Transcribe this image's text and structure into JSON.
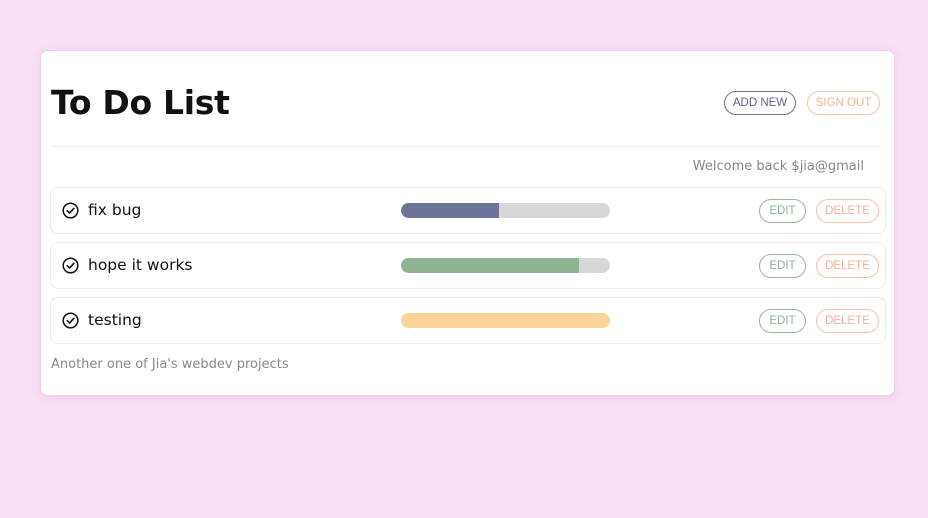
{
  "header": {
    "title": "To Do List",
    "add_label": "ADD NEW",
    "signout_label": "SIGN OUT"
  },
  "welcome": "Welcome back $jia@gmail",
  "tasks": [
    {
      "label": "fix bug",
      "progress": 0.47,
      "color": "#6e7399",
      "edit_label": "EDIT",
      "delete_label": "DELETE",
      "icon": "check-circle-icon"
    },
    {
      "label": "hope it works",
      "progress": 0.85,
      "color": "#8eb493",
      "edit_label": "EDIT",
      "delete_label": "DELETE",
      "icon": "check-circle-icon"
    },
    {
      "label": "testing",
      "progress": 1.0,
      "color": "#fdd59b",
      "edit_label": "EDIT",
      "delete_label": "DELETE",
      "icon": "check-circle-icon"
    }
  ],
  "footer": "Another one of Jia's webdev projects"
}
